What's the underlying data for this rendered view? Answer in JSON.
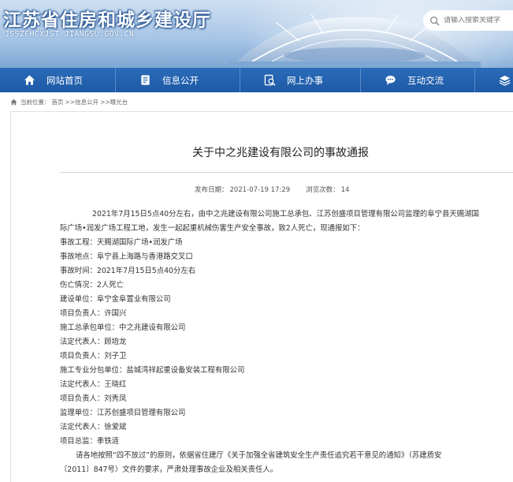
{
  "header": {
    "site_title": "江苏省住房和城乡建设厅",
    "site_url": "JSSZFHCXJST.JIANGSU.GOV.CN",
    "search_placeholder": "请输入搜索关键字"
  },
  "nav": {
    "items": [
      {
        "label": "网站首页",
        "icon": "home-icon"
      },
      {
        "label": "信息公开",
        "icon": "document-icon"
      },
      {
        "label": "网上办事",
        "icon": "search-document-icon"
      },
      {
        "label": "互动交流",
        "icon": "chat-icon"
      },
      {
        "label": "专",
        "icon": "layers-icon"
      }
    ]
  },
  "breadcrumb": {
    "prefix": "当前位置：",
    "items": [
      "首页",
      ">>信息公开",
      ">>曝光台"
    ]
  },
  "article": {
    "title": "关于中之兆建设有限公司的事故通报",
    "publish_label": "发布日期：",
    "publish_date": "2021-07-19 17:29",
    "views_label": "浏览次数：",
    "views": "14",
    "intro_line1": "2021年7月15日5点40分左右，由中之兆建设有限公司施工总承包、江苏创盛项目管理有限公司监理的阜宁县天赐湖国",
    "intro_line2": "际广场•润发广场工程工地，发生一起起重机械伤害生产安全事故，致2人死亡，现通报如下：",
    "lines": [
      "事故工程：天赐湖国际广场•润发广场",
      "事故地点：阜宁县上海路与香港路交叉口",
      "事故时间：2021年7月15日5点40分左右",
      "伤亡情况：2人死亡",
      "建设单位：阜宁金阜置业有限公司",
      "项目负责人：许国兴",
      "施工总承包单位：中之兆建设有限公司",
      "法定代表人：顾培龙",
      "项目负责人：刘子卫",
      "施工专业分包单位：盐城湾祥起重设备安装工程有限公司",
      "法定代表人：王晓红",
      "项目负责人：刘秀凤",
      "监理单位：江苏创盛项目管理有限公司",
      "法定代表人：徐爱斌",
      "项目总监：季铁涟"
    ],
    "closing_line1": "请各地按照“四不放过”的原则，依据省住建厅《关于加强全省建筑安全生产责任追究若干意见的通知》（苏建质安",
    "closing_line2": "〔2011〕847号）文件的要求，严肃处理事故企业及相关责任人。"
  },
  "colors": {
    "nav_bg": "#1d5aa6",
    "header_bg": "#a9c6e6"
  }
}
